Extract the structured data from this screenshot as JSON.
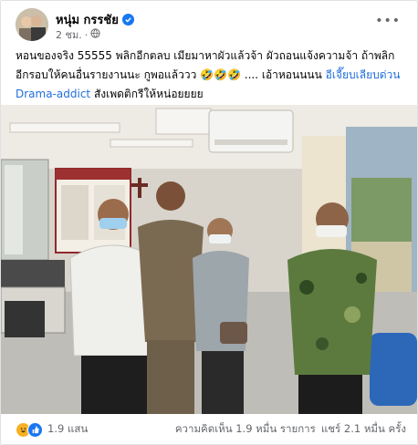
{
  "post": {
    "author": "หนุ่ม กรรชัย",
    "time": "2 ชม.",
    "more": "•••",
    "text_main": "หอนของจริง 55555  พลิกอีกตลบ เมียมาหาผัวแล้วจ้า ผัวถอนแจ้งความจ้า ถ้าพลิกอีกรอบให้คนอื่นรายงานนะ กูพอแล้ววว 🤣🤣🤣 .... เอ้าหอนนนน ",
    "tag1": "อีเจี๊ยบเลียบด่วน",
    "tag2": "Drama-addict",
    "text_end": " สังเพดติกรีให้หน่อยยยย"
  },
  "footer": {
    "reactions": "1.9 แสน",
    "comments": "ความคิดเห็น 1.9 หมื่น รายการ",
    "shares": "แชร์ 2.1 หมื่น ครั้ง"
  },
  "colors": {
    "link": "#216fdb",
    "verified": "#1877f2",
    "like": "#1877f2",
    "haha": "#f7b125"
  }
}
